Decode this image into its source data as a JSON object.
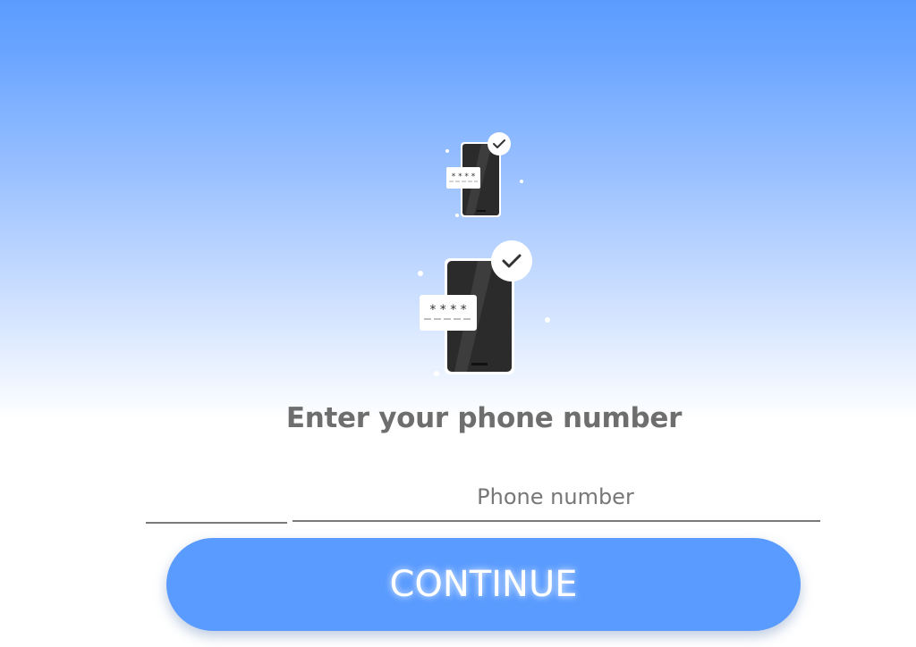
{
  "title": "Enter your phone number",
  "phone": {
    "placeholder": "Phone number",
    "value": ""
  },
  "country": {
    "value": ""
  },
  "continue_label": "CONTINUE",
  "illustration": {
    "otp_mask": "* * * *",
    "icon": "phone-otp-check-icon"
  },
  "colors": {
    "accent": "#5a9bff",
    "gradient_top": "#5b9cff",
    "title": "#6e6e6e",
    "underline": "#7a7a7a"
  }
}
